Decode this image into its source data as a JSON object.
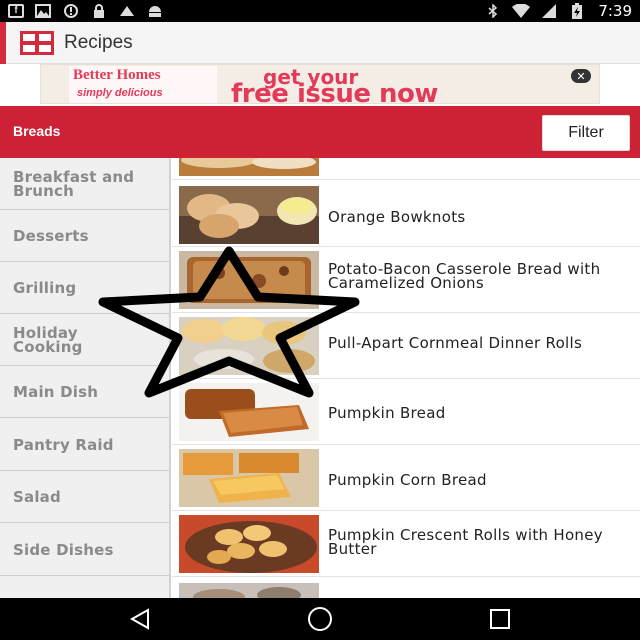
{
  "status_bar": {
    "left_icons": [
      "facebook-icon",
      "gallery-icon",
      "blocked-icon",
      "lock-icon",
      "tapas-icon",
      "android-icon"
    ],
    "right_icons": [
      "bluetooth-icon",
      "wifi-icon",
      "signal-icon",
      "battery-charging-icon"
    ],
    "time": "7:39"
  },
  "app_bar": {
    "title": "Recipes",
    "logo_icon": "bhg-logo-icon",
    "accent_color": "#d32a3e"
  },
  "ad": {
    "magazine_title": "Better Homes",
    "magazine_subtitle": "simply delicious",
    "headline_top": "get your",
    "headline_main": "free issue now",
    "close_symbol": "✕",
    "color": "#e23a58"
  },
  "category": {
    "title": "Breads",
    "filter_label": "Filter",
    "header_color": "#cd2136"
  },
  "sidebar": {
    "items": [
      {
        "label": "Breakfast and Brunch"
      },
      {
        "label": "Desserts"
      },
      {
        "label": "Grilling"
      },
      {
        "label": "Holiday Cooking"
      },
      {
        "label": "Main Dish"
      },
      {
        "label": "Pantry Raid"
      },
      {
        "label": "Salad"
      },
      {
        "label": "Side Dishes"
      }
    ]
  },
  "recipes": [
    {
      "title": "",
      "thumb": "bread-loaf-photo"
    },
    {
      "title": "Orange Bowknots",
      "thumb": "bowknots-photo"
    },
    {
      "title": "Potato-Bacon Casserole Bread with Caramelized Onions",
      "thumb": "casserole-bread-photo"
    },
    {
      "title": "Pull-Apart Cornmeal Dinner Rolls",
      "thumb": "cornmeal-rolls-photo"
    },
    {
      "title": "Pumpkin Bread",
      "thumb": "pumpkin-bread-photo"
    },
    {
      "title": "Pumpkin Corn Bread",
      "thumb": "pumpkin-corn-bread-photo"
    },
    {
      "title": "Pumpkin Crescent Rolls with Honey Butter",
      "thumb": "crescent-rolls-photo"
    },
    {
      "title": "",
      "thumb": "next-recipe-photo"
    }
  ],
  "overlay": {
    "icon": "star-outline-icon"
  },
  "nav_bar": {
    "buttons": [
      "back-icon",
      "home-icon",
      "recents-icon"
    ]
  }
}
